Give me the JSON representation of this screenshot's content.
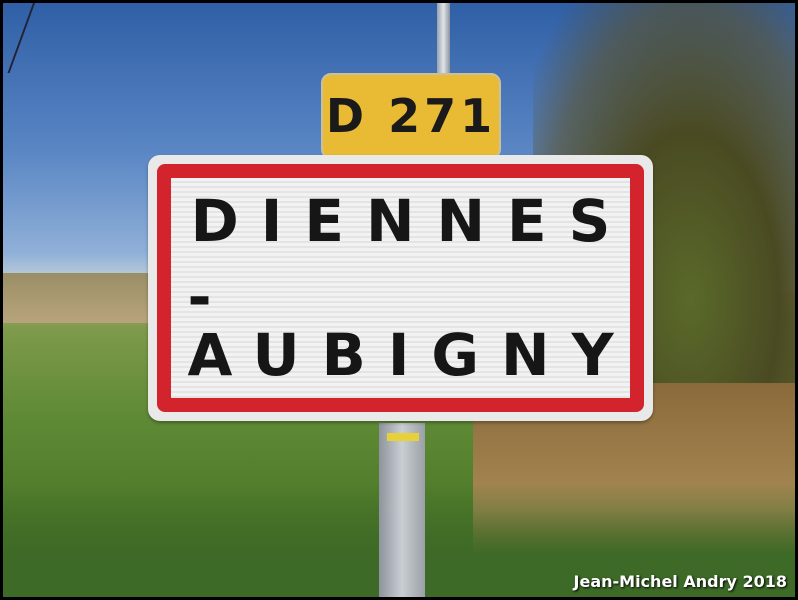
{
  "route_sign": {
    "text": "D 271"
  },
  "town_sign": {
    "line1": "DIENNES",
    "line2": "-AUBIGNY"
  },
  "credit": "Jean-Michel Andry 2018"
}
